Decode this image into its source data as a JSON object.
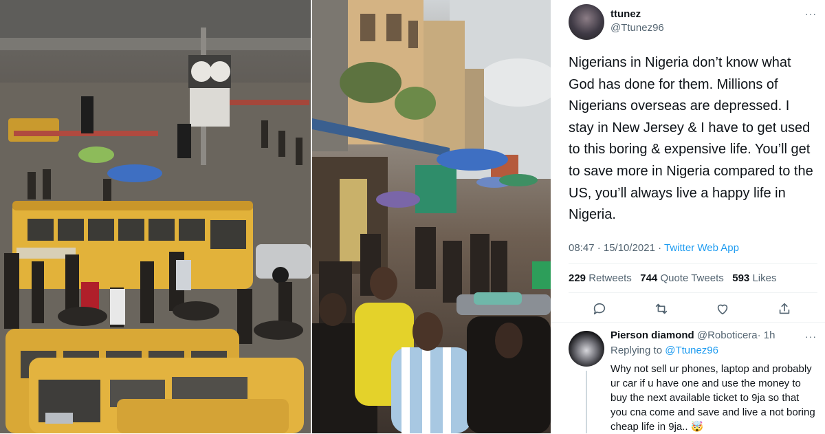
{
  "tweet": {
    "author": {
      "name": "ttunez",
      "handle": "@Ttunez96"
    },
    "text": "Nigerians in Nigeria don’t know what God has done for them. Millions of Nigerians overseas are depressed. I stay in New Jersey & I have to get used to this boring & expensive life. You’ll get to save more in Nigeria compared to the US, you’ll always live a happy life in Nigeria.",
    "timestamp": "08:47 · 15/10/2021",
    "meta_separator": " · ",
    "source": "Twitter Web App",
    "stats": {
      "retweets_count": "229",
      "retweets_label": "Retweets",
      "quotes_count": "744",
      "quotes_label": "Quote Tweets",
      "likes_count": "593",
      "likes_label": "Likes"
    },
    "more_glyph": "···"
  },
  "reply": {
    "author_name": "Pierson diamond",
    "author_handle": "@Roboticera",
    "age": "· 1h",
    "replying_prefix": "Replying to",
    "replying_to": "@Ttunez96",
    "text": "Why not sell ur phones, laptop and probably ur car if u have one and use the money to buy the next available ticket to 9ja so that you cna come and save and live a not boring cheap life in 9ja.. 🤯",
    "more_glyph": "···"
  },
  "icons": {
    "reply": "reply-icon",
    "retweet": "retweet-icon",
    "like": "heart-icon",
    "share": "share-icon",
    "more": "more-icon"
  },
  "colors": {
    "text_primary": "#0f1419",
    "text_secondary": "#536471",
    "link": "#1d9bf0",
    "divider": "#eff3f4",
    "danfo_yellow": "#e2b23a"
  }
}
